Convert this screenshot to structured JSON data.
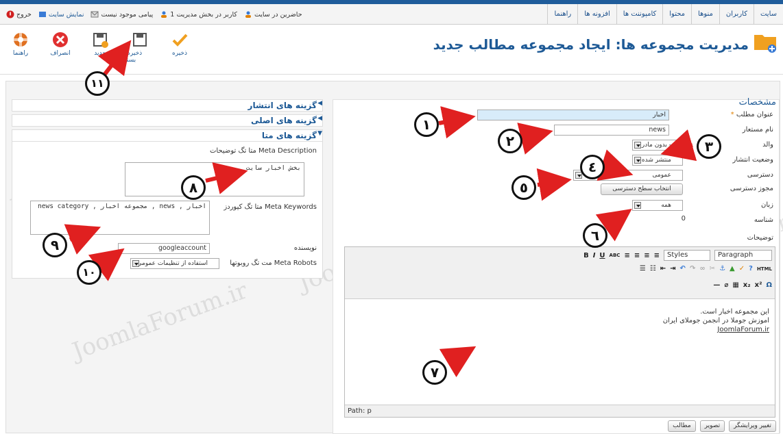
{
  "menubar": {
    "items": [
      "سایت",
      "کاربران",
      "منوها",
      "محتوا",
      "کامپوننت ها",
      "افزونه ها",
      "راهنما"
    ],
    "status": [
      {
        "text": "حاضرین در سایت",
        "icon": "users-icon"
      },
      {
        "text": "1 کاربر در بخش مدیریت",
        "icon": "admin-user-icon"
      },
      {
        "text": "پیامی موجود نیست",
        "icon": "message-icon"
      },
      {
        "text": "نمایش سایت",
        "icon": "view-site-icon"
      },
      {
        "text": "خروج",
        "icon": "logout-icon"
      }
    ]
  },
  "toolbar": {
    "page_title": "مدیریت مجموعه ها: ایجاد مجموعه مطالب جدید",
    "save": "ذخیره",
    "save_close": "ذخیره و بستن",
    "save_new": "جدید",
    "cancel": "انصراف",
    "help": "راهنما"
  },
  "details": {
    "section_title": "مشخصات",
    "title_label": "عنوان مطلب",
    "title_required": "*",
    "title_value": "اخبار",
    "alias_label": "نام مستعار",
    "alias_value": "news",
    "parent_label": "والد",
    "parent_value": "- بدون مادر -",
    "state_label": "وضعیت انتشار",
    "state_value": "منتشر شده",
    "access_label": "دسترسی",
    "access_value": "عمومی",
    "permissions_label": "مجوز دسترسی",
    "permissions_button": "انتخاب سطح دسترسی",
    "language_label": "زبان",
    "language_value": "همه",
    "id_label": "شناسه",
    "id_value": "0",
    "description_label": "توضیحات"
  },
  "editor": {
    "styles": "Styles",
    "paragraph": "Paragraph",
    "body_lines": [
      "این مجموعه اخبار است.",
      "اموزش جوملا در انجمن جوملای ایران",
      "JoomlaForum.ir"
    ],
    "path": "Path: p"
  },
  "editor_buttons": {
    "article": "مطالب",
    "image": "تصویر",
    "toggle": "تغییر ویرایشگر"
  },
  "sidebar": {
    "panel_publish": "گزینه های انتشار",
    "panel_basic": "گزینه های اصلی",
    "panel_meta": "گزینه های متا",
    "meta_description_label": "Meta Description متا تگ توضیحات",
    "meta_description_value": "بخش اخبار سایت",
    "meta_keywords_label": "Meta Keywords متا تگ کیوردز",
    "meta_keywords_value": "اخبار , news , مجموعه اخبار , news category",
    "author_label": "نویسنده",
    "author_value": "googleaccount",
    "robots_label": "Meta Robots مت تگ روبوتها",
    "robots_value": "استفاده از تنظیمات عمومی"
  },
  "annotations": [
    "١",
    "٢",
    "٣",
    "٤",
    "٥",
    "٦",
    "٧",
    "٨",
    "٩",
    "١٠",
    "١١"
  ],
  "watermark": "JoomlaForum.ir",
  "colors": {
    "brand_blue": "#1e5a96",
    "arrow_red": "#e02020",
    "required_orange": "#e08000"
  }
}
